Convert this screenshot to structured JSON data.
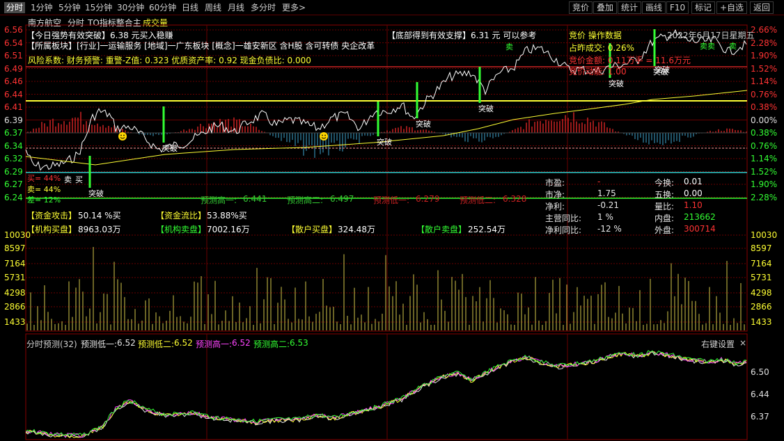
{
  "toolbar": {
    "periods": [
      "分时",
      "1分钟",
      "5分钟",
      "15分钟",
      "30分钟",
      "60分钟",
      "日线",
      "周线",
      "月线",
      "多分时",
      "更多>"
    ],
    "right": [
      "竞价",
      "叠加",
      "统计",
      "画线",
      "F10",
      "标记",
      "+自选",
      "返回"
    ]
  },
  "header": {
    "stock": "南方航空",
    "mode": "分时",
    "indicator": "TO指标整合主",
    "volume_label": "成交量"
  },
  "info": {
    "line1": "【今日强势有效突破】6.38 元买入稳赚",
    "line2": "【所属板块】[行业]一运输服务 [地域]一广东板块 [概念]一雄安新区 含H股 含可转债 央企改革",
    "line3": "风险系数: 财务预警: 重警-Z值: 0.323 优质资产率: 0.92 现金负债比: 0.000",
    "support": "【底部得到有效支撑】6.31 元 可以参考",
    "auction_title": "竞价 操作数据",
    "date": "2022年6月17日星期五",
    "prev_close_ratio": "占昨成交: 0.26%",
    "auction_amount": "竞价金额: 0.11万手 = 11.6万元",
    "auction_momentum": "竞价动能: 1.00"
  },
  "price_axis": {
    "left": [
      "6.56",
      "6.54",
      "6.51",
      "6.49",
      "6.46",
      "6.44",
      "6.41",
      "6.39",
      "6.37",
      "6.34",
      "6.32",
      "6.29",
      "6.27",
      "6.24"
    ],
    "right": [
      "2.66%",
      "2.28%",
      "1.90%",
      "1.52%",
      "1.14%",
      "0.76%",
      "0.38%",
      "0.00%",
      "0.38%",
      "0.76%",
      "1.14%",
      "1.52%",
      "1.90%",
      "2.28%"
    ]
  },
  "price_marks": {
    "breaks": [
      "突破",
      "突破",
      "突破",
      "突破",
      "突破",
      "突破"
    ],
    "sells": [
      "卖",
      "卖卖",
      "卖"
    ],
    "buy": "买",
    "sell_s": "卖"
  },
  "sentiment": {
    "buy_pct": "买= 44%",
    "sell_pct": "卖= 44%",
    "diff_pct": "差= 12%"
  },
  "predict_row": [
    {
      "label": "预测高一:",
      "value": "6.441",
      "color": "#33cc33"
    },
    {
      "label": "预测高二:",
      "value": "6.497",
      "color": "#33cc33"
    },
    {
      "label": "预测低一:",
      "value": "6.279",
      "color": "#cc2222"
    },
    {
      "label": "预测低二:",
      "value": "6.328",
      "color": "#cc2222"
    }
  ],
  "fund_flow": {
    "attack": {
      "label": "【资金攻击】",
      "value": "50.14 %买"
    },
    "flow": {
      "label": "【资金流比】",
      "value": "53.88%买"
    },
    "inst_buy": {
      "label": "【机构买盘】",
      "value": "8963.03万"
    },
    "inst_sell": {
      "label": "【机构卖盘】",
      "value": "7002.16万"
    },
    "retail_buy": {
      "label": "【散户买盘】",
      "value": "324.48万"
    },
    "retail_sell": {
      "label": "【散户卖盘】",
      "value": "252.54万"
    }
  },
  "stats": [
    {
      "l": "市盈:",
      "v": "-",
      "l2": "今换:",
      "v2": "0.01",
      "c2": "#ffffff"
    },
    {
      "l": "市净:",
      "v": "1.75",
      "l2": "五换:",
      "v2": "0.00",
      "c2": "#ffffff"
    },
    {
      "l": "净利:",
      "v": "-0.21",
      "l2": "量比:",
      "v2": "1.10",
      "c2": "#ff3333"
    },
    {
      "l": "主营同比:",
      "v": "1 %",
      "l2": "内盘:",
      "v2": "213662",
      "c2": "#33ff33"
    },
    {
      "l": "净利同比:",
      "v": "-12 %",
      "l2": "外盘:",
      "v2": "300714",
      "c2": "#ff3333"
    }
  ],
  "volume_axis": [
    "10030",
    "8597",
    "7164",
    "5731",
    "4298",
    "2866",
    "1433"
  ],
  "bottom": {
    "title": "分时预测(32)",
    "items": [
      {
        "label": "预测低一:",
        "value": "6.52",
        "color": "#e8e8e8"
      },
      {
        "label": "预测低二:",
        "value": "6.52",
        "color": "#ffff33"
      },
      {
        "label": "预测高一:",
        "value": "6.52",
        "color": "#ff44ff"
      },
      {
        "label": "预测高二:",
        "value": "6.53",
        "color": "#33ff33"
      }
    ],
    "settings": "右键设置",
    "close": "×",
    "axis": [
      "6.50",
      "6.44",
      "6.37"
    ]
  },
  "colors": {
    "up": "#ff3333",
    "down": "#33ff33",
    "yellow": "#ffff33",
    "grid": "#6a0000"
  }
}
